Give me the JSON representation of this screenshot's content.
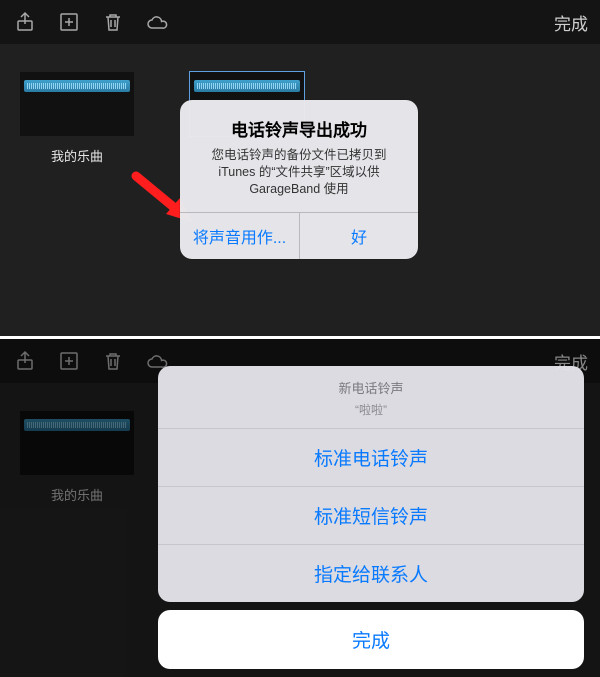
{
  "toolbar": {
    "done": "完成",
    "icons": {
      "share": "share-icon",
      "add": "add-icon",
      "trash": "trash-icon",
      "cloud": "cloud-icon"
    }
  },
  "song": {
    "label": "我的乐曲"
  },
  "alert": {
    "title": "电话铃声导出成功",
    "message": "您电话铃声的备份文件已拷贝到 iTunes 的“文件共享”区域以供 GarageBand 使用",
    "left": "将声音用作...",
    "right": "好"
  },
  "sheet": {
    "header": "新电话铃声",
    "sub": "“啦啦”",
    "items": [
      "标准电话铃声",
      "标准短信铃声",
      "指定给联系人"
    ],
    "cancel": "完成"
  }
}
